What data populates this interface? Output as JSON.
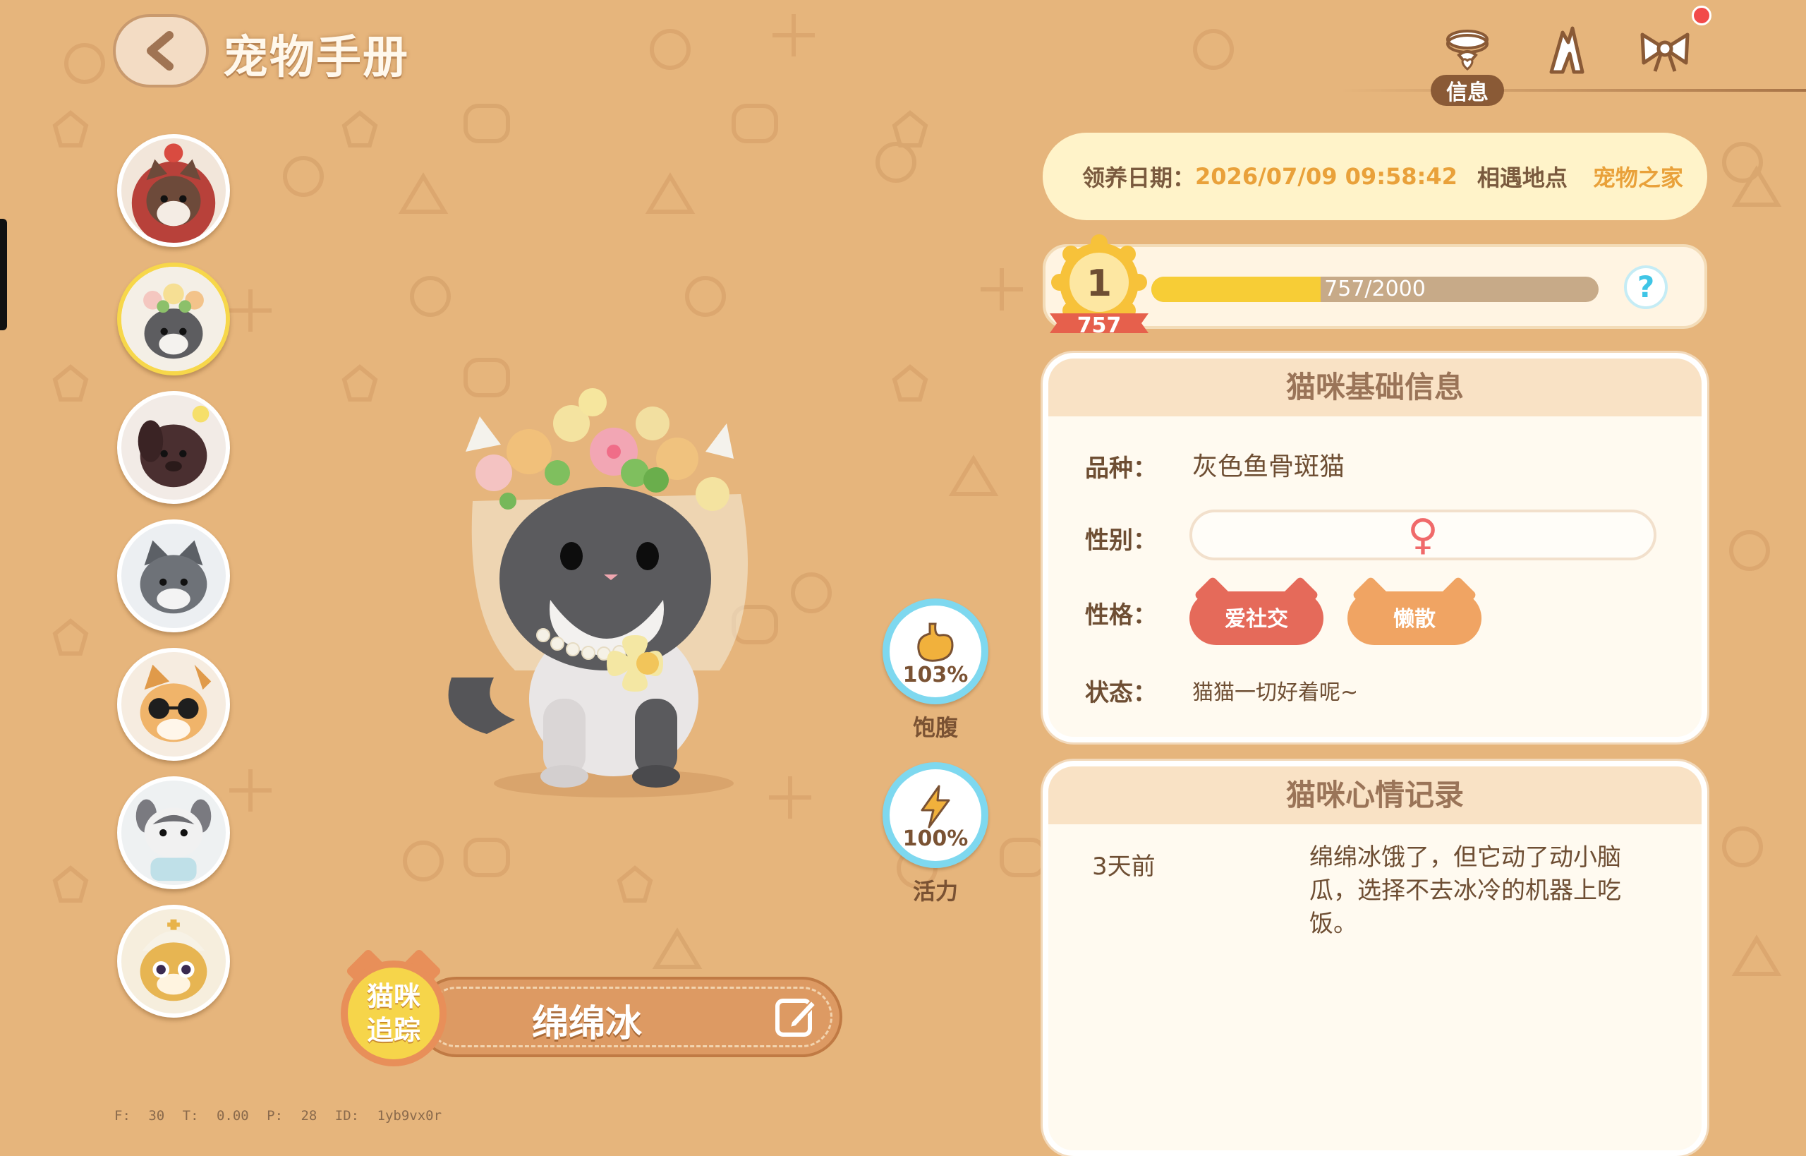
{
  "header": {
    "title": "宠物手册",
    "tabs": [
      {
        "name": "collar",
        "label": "信息",
        "active": true
      },
      {
        "name": "skills",
        "label": ""
      },
      {
        "name": "bow",
        "label": ""
      }
    ]
  },
  "cats": [
    {
      "name": "red-hood-cat",
      "selected": false
    },
    {
      "name": "flower-crown-cat",
      "selected": true
    },
    {
      "name": "black-cat",
      "selected": false
    },
    {
      "name": "gray-cat",
      "selected": false
    },
    {
      "name": "sunglasses-cat",
      "selected": false
    },
    {
      "name": "bunny-ear-cat",
      "selected": false
    },
    {
      "name": "nurse-hat-cat",
      "selected": false
    }
  ],
  "stats": [
    {
      "label": "饱腹",
      "value": "103%",
      "icon": "stomach-icon"
    },
    {
      "label": "活力",
      "value": "100%",
      "icon": "lightning-icon"
    }
  ],
  "pet": {
    "track_label": "猫咪追踪",
    "name": "绵绵冰"
  },
  "debug": "F: 30   T: 0.00   P: 28   ID: 1yb9vx0r",
  "adoption": {
    "date_label": "领养日期：",
    "date_value": "2026/07/09 09:58:42",
    "place_label": "相遇地点",
    "place_value": "宠物之家"
  },
  "level": {
    "level": "1",
    "points": "757",
    "xp_text": "757/2000",
    "xp_current": 757,
    "xp_max": 2000,
    "help": "?"
  },
  "basic_info": {
    "title": "猫咪基础信息",
    "breed_label": "品种：",
    "breed_value": "灰色鱼骨斑猫",
    "gender_label": "性别：",
    "gender_value": "♀",
    "personality_label": "性格：",
    "traits": [
      "爱社交",
      "懒散"
    ],
    "status_label": "状态：",
    "status_value": "猫猫一切好着呢~"
  },
  "mood": {
    "title": "猫咪心情记录",
    "entries": [
      {
        "time": "3天前",
        "text": "绵绵冰饿了，但它动了动小脑瓜，选择不去冰冷的机器上吃饭。"
      }
    ]
  },
  "colors": {
    "background": "#e6b57c",
    "accent_yellow": "#f7cd36",
    "accent_blue": "#7ed8ef",
    "trait_red": "#e56a5a",
    "trait_orange": "#f0a463"
  }
}
